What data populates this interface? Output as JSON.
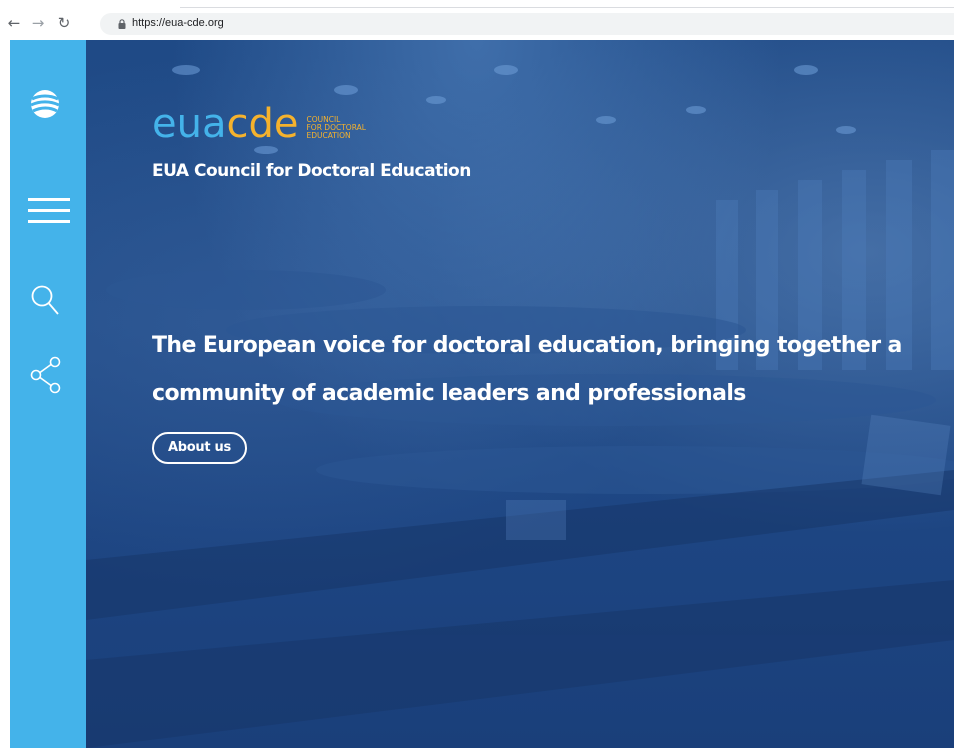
{
  "browser": {
    "url": "https://eua-cde.org",
    "icons": [
      "back-arrow-icon",
      "forward-arrow-icon",
      "reload-icon",
      "lock-icon"
    ]
  },
  "sidebar": {
    "icons": [
      "globe-logo-icon",
      "hamburger-menu-icon",
      "search-icon",
      "share-icon"
    ],
    "color": "#44b3ea"
  },
  "logo": {
    "part1": "eua",
    "part2": "cde",
    "sub_line1": "COUNCIL",
    "sub_line2": "FOR DOCTORAL",
    "sub_line3": "EDUCATION",
    "color_part1": "#44b3ea",
    "color_part2": "#f5b22d"
  },
  "hero": {
    "site_name": "EUA Council for Doctoral Education",
    "tagline_line1": "The European voice for doctoral education, bringing together a",
    "tagline_line2": "community of academic leaders and professionals",
    "about_button": "About us",
    "overlay_color": "#1f4a86"
  }
}
